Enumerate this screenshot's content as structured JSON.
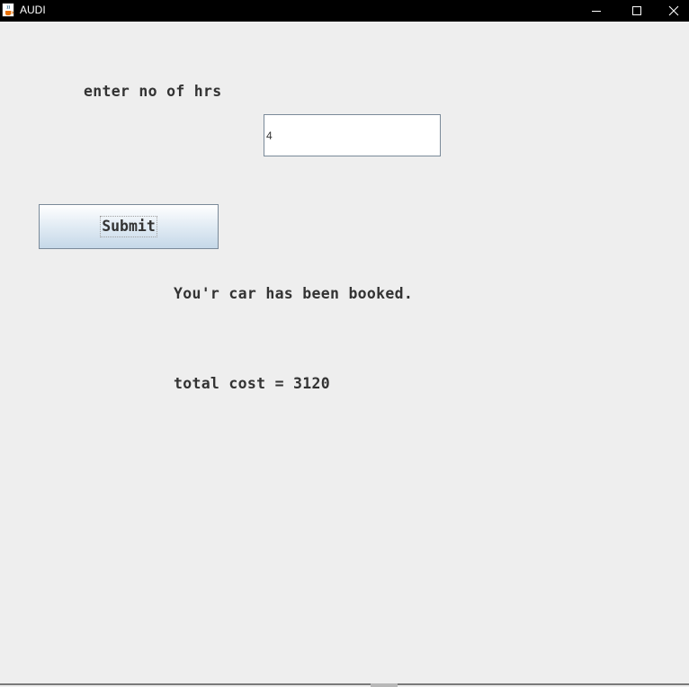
{
  "window": {
    "title": "AUDI",
    "icon": "java-cup-icon",
    "controls": {
      "minimize_icon": "minimize-icon",
      "maximize_icon": "maximize-icon",
      "close_icon": "close-icon"
    }
  },
  "form": {
    "hours_label": "enter no of hrs",
    "hours_value": "4",
    "submit_label": "Submit"
  },
  "result": {
    "message": "You'r car has been booked.",
    "total_cost": "total cost = 3120"
  },
  "colors": {
    "titlebar": "#000000",
    "background": "#eeeeee",
    "text": "#333333",
    "button_gradient_bottom": "#c5d8e8"
  }
}
